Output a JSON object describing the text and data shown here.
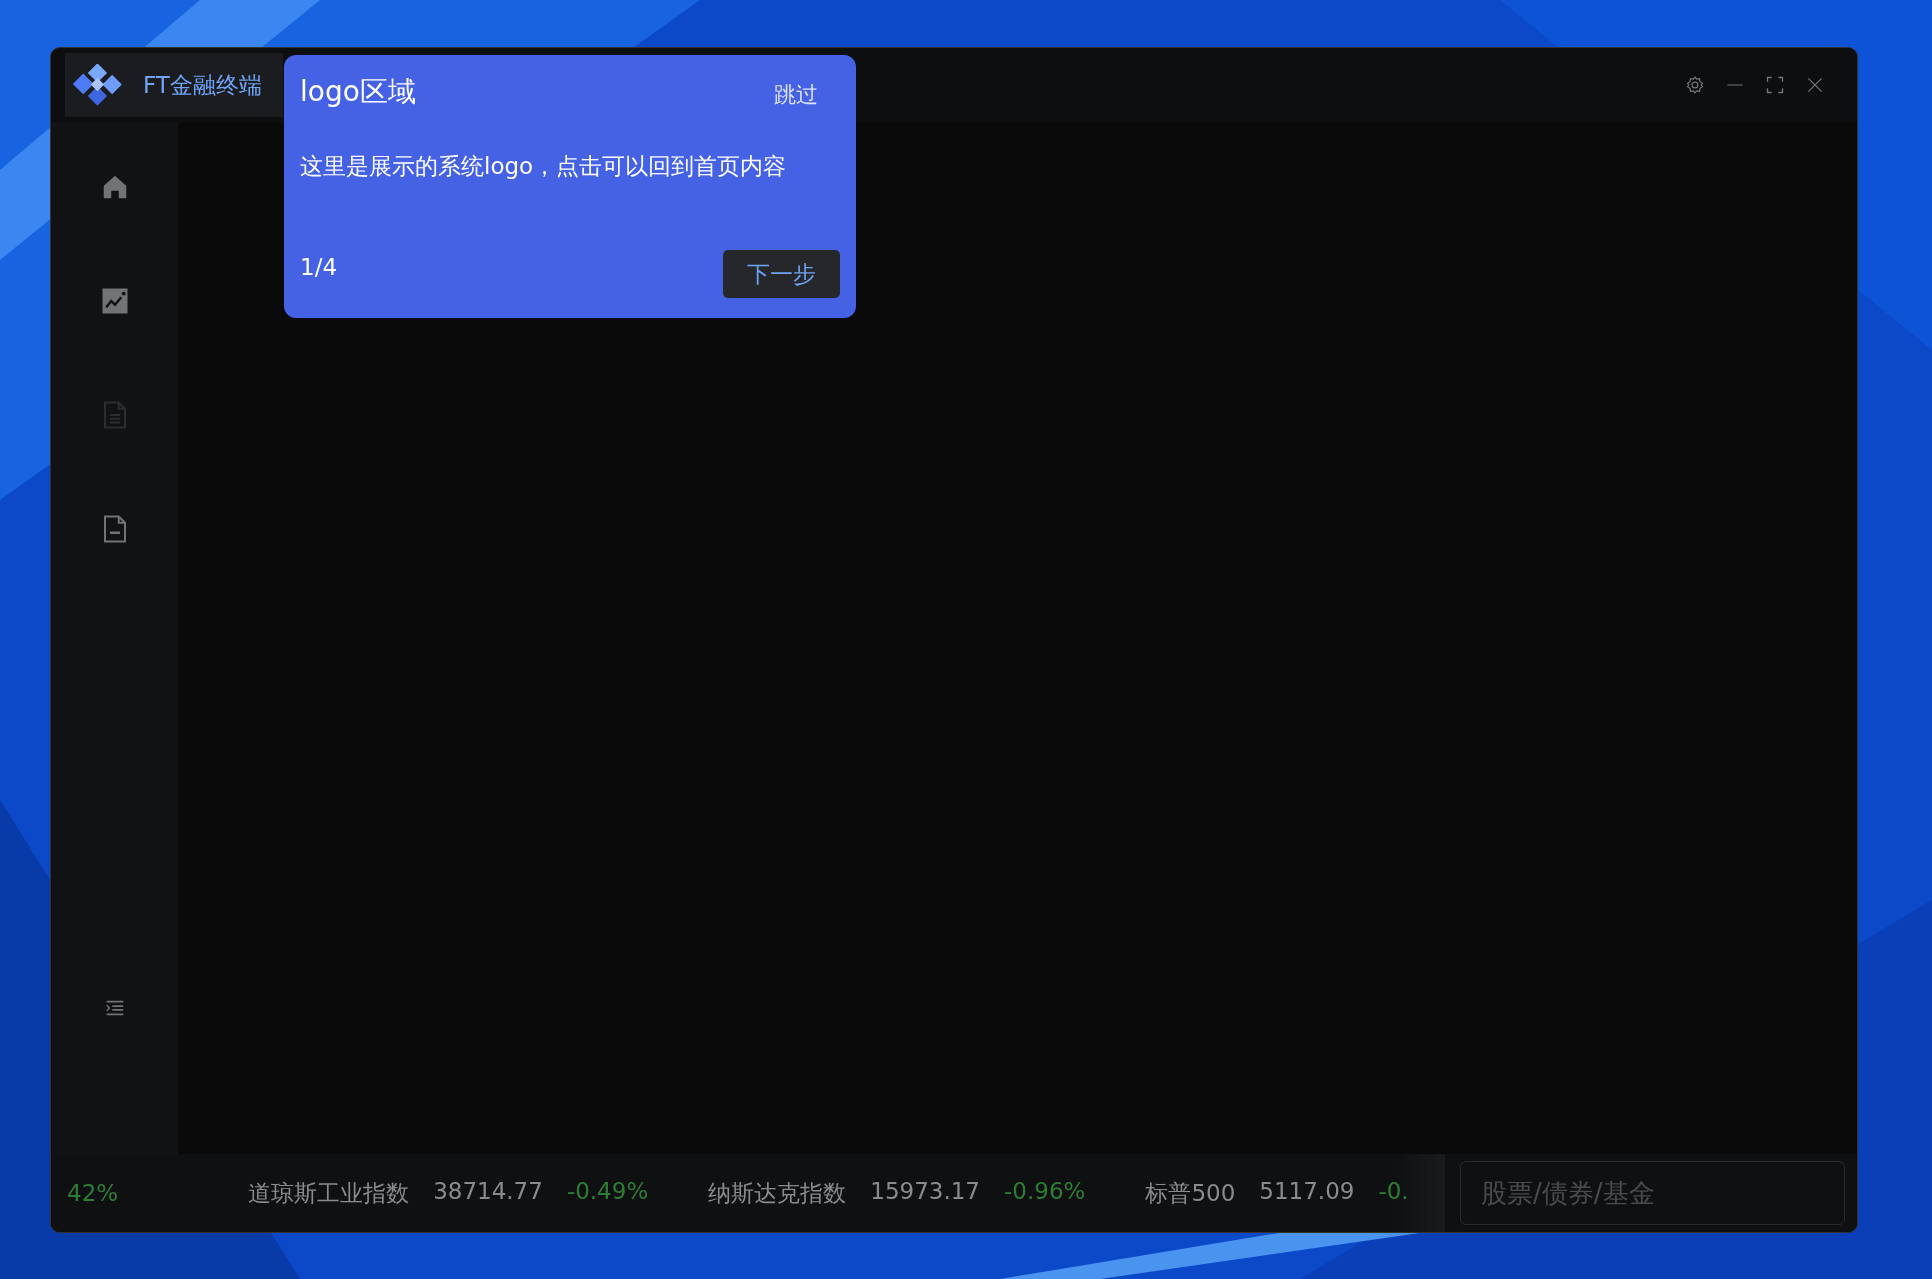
{
  "window": {
    "app_name": "FT金融终端"
  },
  "sidebar": {
    "items": [
      {
        "kind": "home",
        "disabled": false
      },
      {
        "kind": "chart",
        "disabled": false
      },
      {
        "kind": "document",
        "disabled": true
      },
      {
        "kind": "form",
        "disabled": false
      }
    ]
  },
  "tour": {
    "title": "logo区域",
    "skip": "跳过",
    "body": "这里是展示的系统logo，点击可以回到首页内容",
    "step": "1/4",
    "next": "下一步"
  },
  "ticker": [
    {
      "change": "42%",
      "color": "#2e7d32"
    },
    {
      "name": "道琼斯工业指数",
      "value": "38714.77",
      "change": "-0.49%",
      "color": "#2e7d32"
    },
    {
      "name": "纳斯达克指数",
      "value": "15973.17",
      "change": "-0.96%",
      "color": "#2e7d32"
    },
    {
      "name": "标普500",
      "value": "5117.09",
      "change": "-0.",
      "color": "#2e7d32"
    }
  ],
  "search": {
    "placeholder": "股票/债券/基金"
  }
}
